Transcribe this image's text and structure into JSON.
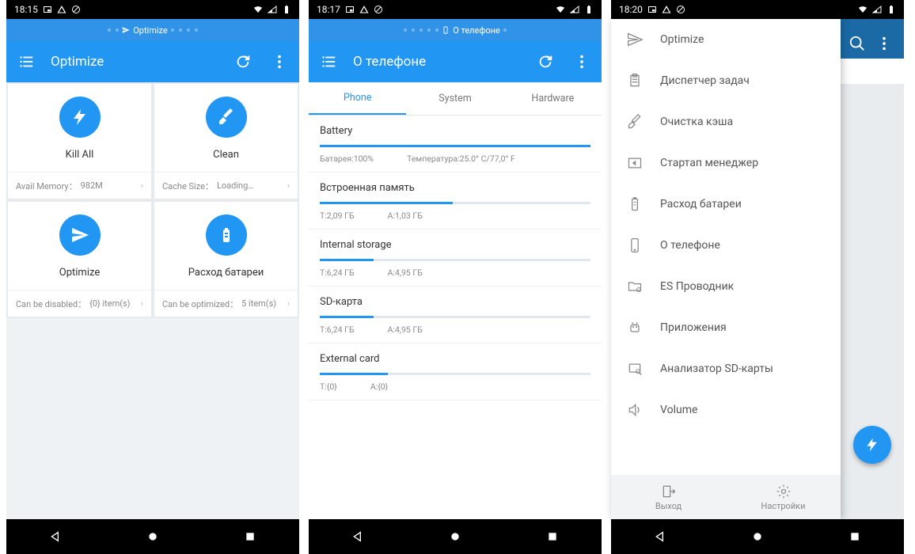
{
  "phones": {
    "a": {
      "status_time": "18:15",
      "tab_label": "Optimize",
      "title": "Optimize",
      "cards": [
        {
          "title": "Kill All",
          "sub_key": "Avail Memory：",
          "sub_val": "982M"
        },
        {
          "title": "Clean",
          "sub_key": "Cache Size：",
          "sub_val": "Loading…"
        },
        {
          "title": "Optimize",
          "sub_key": "Can be disabled：",
          "sub_val": "{0} item(s)"
        },
        {
          "title": "Расход батареи",
          "sub_key": "Can be optimized：",
          "sub_val": "5 item(s)"
        }
      ]
    },
    "b": {
      "status_time": "18:17",
      "tab_label": "О телефоне",
      "title": "О телефоне",
      "tabs": [
        "Phone",
        "System",
        "Hardware"
      ],
      "sections": [
        {
          "title": "Battery",
          "fill": 100,
          "left": "Батарея:100%",
          "right": "Температура:25.0° C/77,0° F"
        },
        {
          "title": "Встроенная память",
          "fill": 49,
          "left": "T:2,09 ГБ",
          "right": "A:1,03 ГБ"
        },
        {
          "title": "Internal storage",
          "fill": 20,
          "left": "T:6,24 ГБ",
          "right": "A:4,95 ГБ"
        },
        {
          "title": "SD-карта",
          "fill": 20,
          "left": "T:6,24 ГБ",
          "right": "A:4,95 ГБ"
        },
        {
          "title": "External card",
          "fill": 25,
          "left": "T:{0}",
          "right": "A:{0}"
        }
      ]
    },
    "c": {
      "status_time": "18:20",
      "menu": [
        "Optimize",
        "Диспетчер задач",
        "Очистка кэша",
        "Стартап менеджер",
        "Расход батареи",
        "О телефоне",
        "ES Проводник",
        "Приложения",
        "Анализатор SD-карты",
        "Volume"
      ],
      "bottom": {
        "exit": "Выход",
        "settings": "Настройки"
      }
    }
  }
}
